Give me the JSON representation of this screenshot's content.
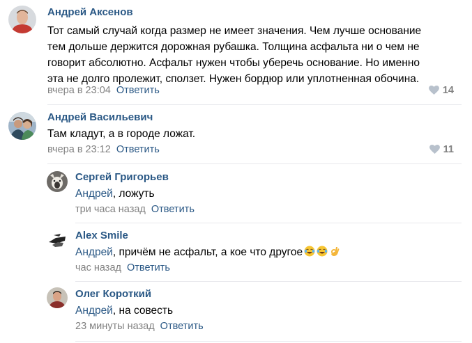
{
  "comments": [
    {
      "author": "Андрей Аксенов",
      "text_lines": [
        "Тот самый случай когда размер не имеет значения. Чем лучше основание",
        "тем дольше держится дорожная рубашка. Толщина асфальта ни о чем не",
        "говорит абсолютно. Асфальт нужен чтобы уберечь основание. Но именно",
        "эта не долго пролежит, сползет. Нужен бордюр или уплотненная обочина."
      ],
      "time": "вчера в 23:04",
      "reply_label": "Ответить",
      "likes": "14"
    },
    {
      "author": "Андрей Васильевич",
      "text": "Там кладут, а в городе ложат.",
      "time": "вчера в 23:12",
      "reply_label": "Ответить",
      "likes": "11"
    }
  ],
  "replies": [
    {
      "author": "Сергей Григорьев",
      "mention": "Андрей",
      "text": ", ложуть",
      "time": "три часа назад",
      "reply_label": "Ответить"
    },
    {
      "author": "Alex Smile",
      "mention": "Андрей",
      "text": ", причём не асфальт, а кое что другое",
      "emojis": [
        "tears-of-joy-emoji",
        "tears-of-joy-emoji",
        "ok-hand-emoji"
      ],
      "time": "час назад",
      "reply_label": "Ответить"
    },
    {
      "author": "Олег Короткий",
      "mention": "Андрей",
      "text": ", на совесть",
      "time": "23 минуты назад",
      "reply_label": "Ответить"
    }
  ],
  "colors": {
    "link": "#2a5885",
    "meta": "#828282",
    "divider": "#e7e8ec"
  }
}
